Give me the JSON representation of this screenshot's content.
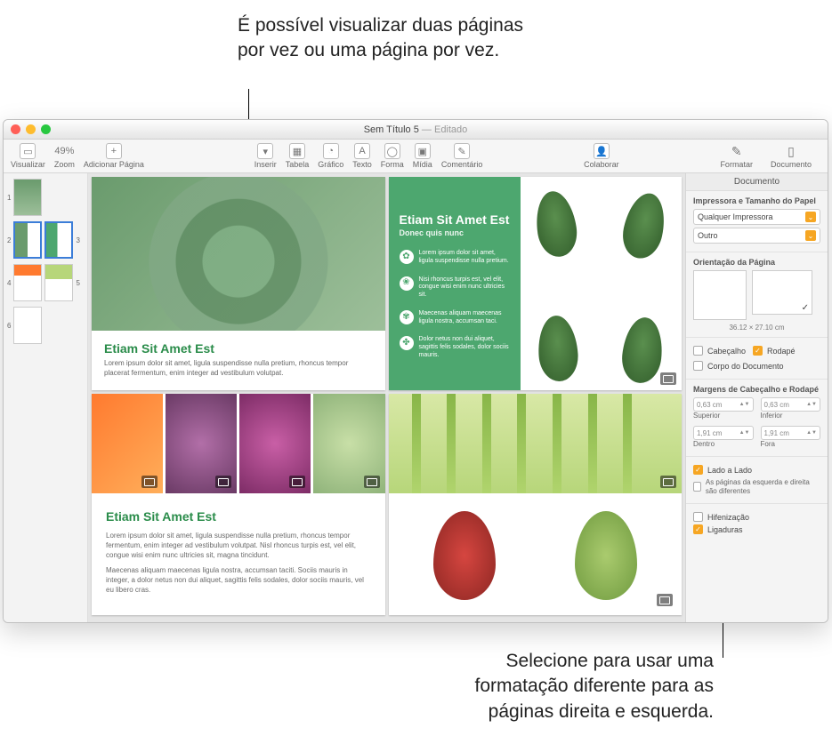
{
  "callouts": {
    "top": "É possível visualizar duas páginas por vez ou uma página por vez.",
    "bottom": "Selecione para usar uma formatação diferente para as páginas direita e esquerda."
  },
  "window": {
    "doc_name": "Sem Título 5",
    "status": "— Editado"
  },
  "toolbar": {
    "visualizar": "Visualizar",
    "zoom": "Zoom",
    "zoom_value": "49%",
    "adicionar_pagina": "Adicionar Página",
    "inserir": "Inserir",
    "tabela": "Tabela",
    "grafico": "Gráfico",
    "texto": "Texto",
    "forma": "Forma",
    "midia": "Mídia",
    "comentario": "Comentário",
    "colaborar": "Colaborar",
    "formatar": "Formatar",
    "documento": "Documento"
  },
  "thumbs": [
    "1",
    "2",
    "3",
    "4",
    "5",
    "6"
  ],
  "page1": {
    "title": "Etiam Sit Amet Est",
    "body": "Lorem ipsum dolor sit amet, ligula suspendisse nulla pretium, rhoncus tempor placerat fermentum, enim integer ad vestibulum volutpat."
  },
  "page2": {
    "title": "Etiam Sit Amet Est",
    "subtitle": "Donec quis nunc",
    "bullets": [
      "Lorem ipsum dolor sit amet, ligula suspendisse nulla pretium.",
      "Nisi rhoncus turpis est, vel elit, congue wisi enim nunc ultricies sit.",
      "Maecenas aliquam maecenas ligula nostra, accumsan taci.",
      "Dolor netus non dui aliquet, sagittis felis sodales, dolor sociis mauris."
    ]
  },
  "page4": {
    "title": "Etiam Sit Amet Est",
    "p1": "Lorem ipsum dolor sit amet, ligula suspendisse nulla pretium, rhoncus tempor fermentum, enim integer ad vestibulum volutpat. Nisl rhoncus turpis est, vel elit, congue wisi enim nunc ultricies sit, magna tincidunt.",
    "p2": "Maecenas aliquam maecenas ligula nostra, accumsan taciti. Sociis mauris in integer, a dolor netus non dui aliquet, sagittis felis sodales, dolor sociis mauris, vel eu libero cras."
  },
  "inspector": {
    "tab": "Documento",
    "printer_section": "Impressora e Tamanho do Papel",
    "printer": "Qualquer Impressora",
    "paper": "Outro",
    "orient_section": "Orientação da Página",
    "dims": "36.12 × 27.10 cm",
    "cabecalho": "Cabeçalho",
    "rodape": "Rodapé",
    "corpo": "Corpo do Documento",
    "margins_section": "Margens de Cabeçalho e Rodapé",
    "m_sup_v": "0,63 cm",
    "m_sup_l": "Superior",
    "m_inf_v": "0,63 cm",
    "m_inf_l": "Inferior",
    "m_den_v": "1,91 cm",
    "m_den_l": "Dentro",
    "m_for_v": "1,91 cm",
    "m_for_l": "Fora",
    "lado": "Lado a Lado",
    "lado_sub": "As páginas da esquerda e direita são diferentes",
    "hif": "Hifenização",
    "lig": "Ligaduras"
  }
}
